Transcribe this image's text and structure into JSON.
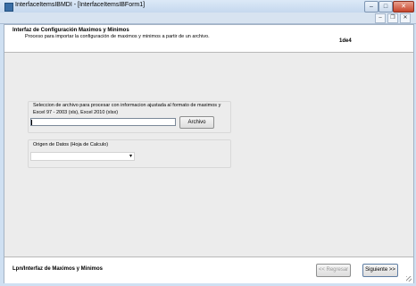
{
  "window": {
    "title": "InterfaceItemsIBMDI - [InterfaceItemsIBForm1]",
    "controls": {
      "minimize": "–",
      "maximize": "□",
      "close": "✕"
    },
    "mdi_controls": {
      "minimize": "–",
      "restore": "❐",
      "close": "✕"
    }
  },
  "header": {
    "title": "Interfaz de Configuración Maximos y Minimos",
    "subtitle": "Proceso para importar la configuración de maximos y minimos  a partir de un archivo.",
    "step": "1de4"
  },
  "file_group": {
    "label_line1": "Seleccion de archivo para procesar con informacion ajustada al formato de maximos y",
    "label_line2": "Excel 97 - 2003 (xls), Excel 2010 (xlsx)",
    "input_value": "",
    "button_label": "Archivo"
  },
  "origin_group": {
    "label": "Origen de Datos (Hoja de Calculo)",
    "selected_value": "",
    "arrow": "▾"
  },
  "footer": {
    "title": "Lpn/Interfaz de Maximos y Minimos",
    "back_label": "<< Regresar",
    "next_label": "Siguiente >>"
  }
}
